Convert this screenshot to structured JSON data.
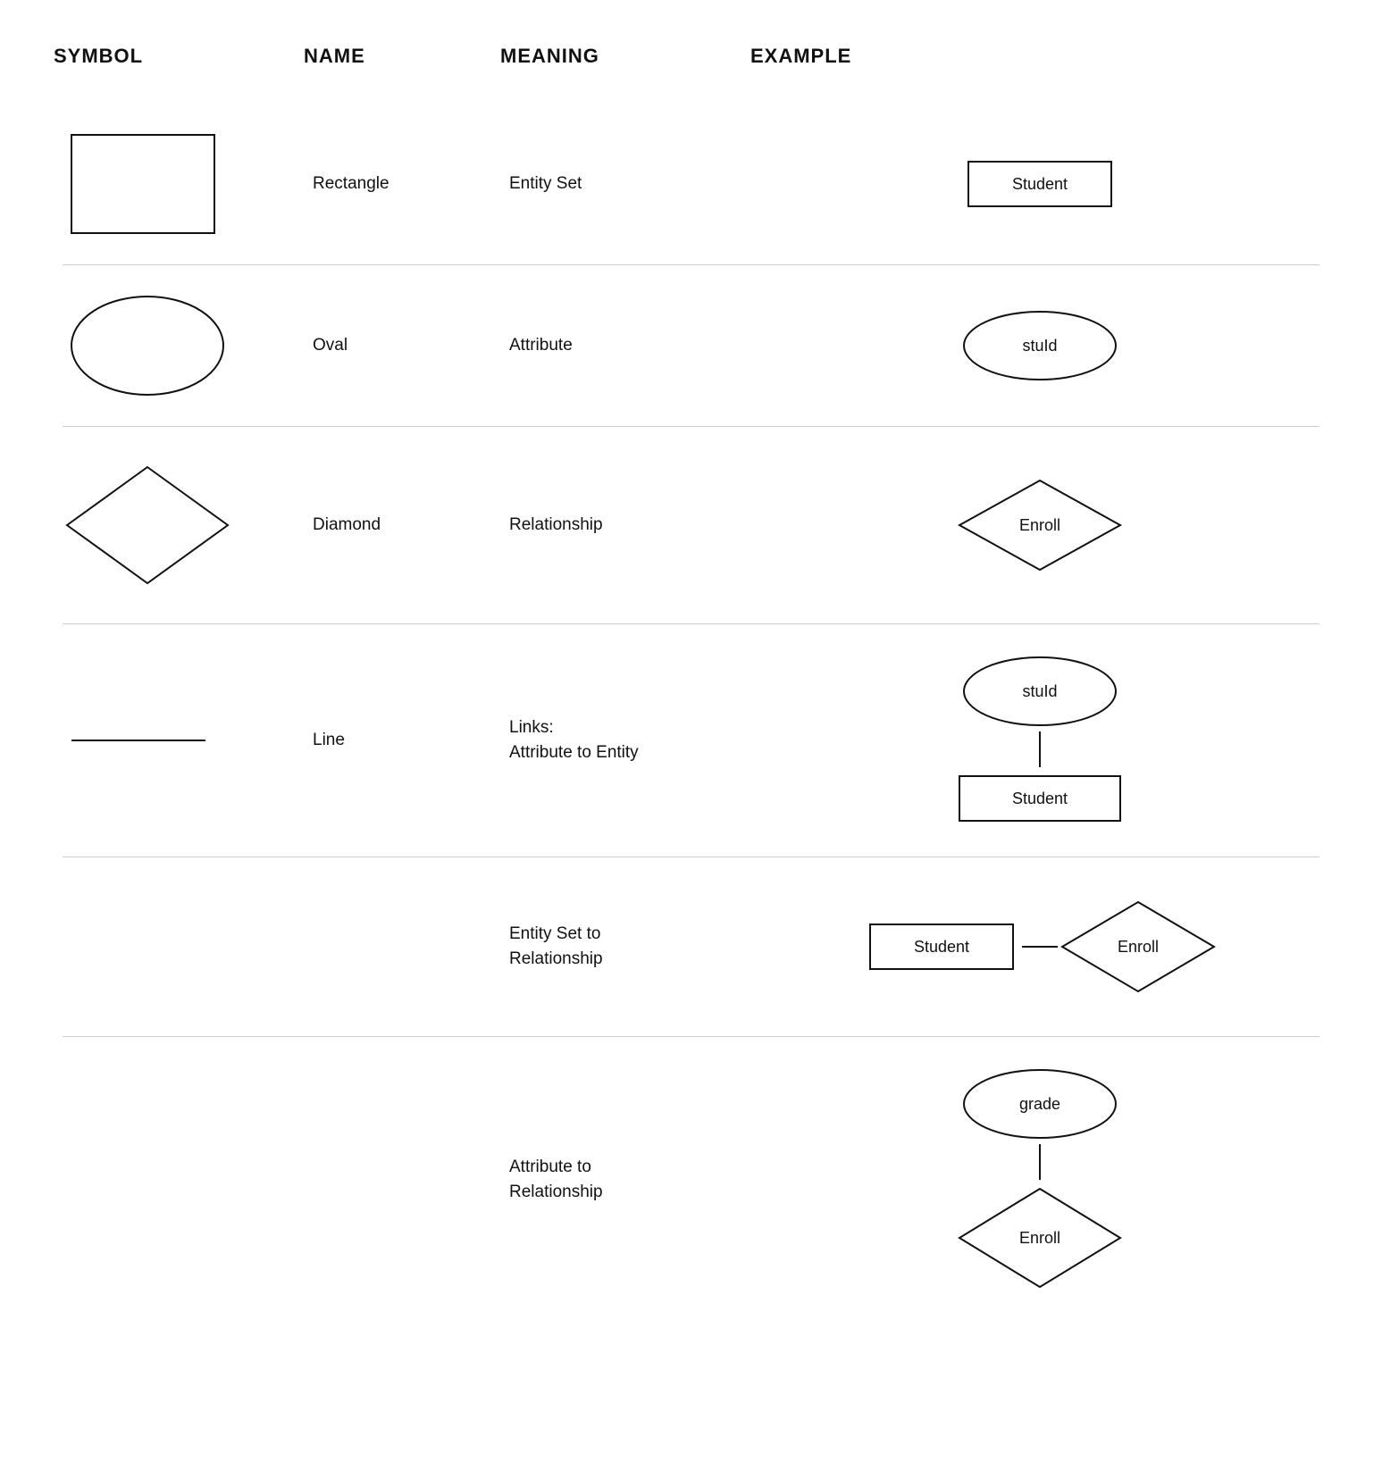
{
  "header": {
    "col1": "SYMBOL",
    "col2": "NAME",
    "col3": "MEANING",
    "col4": "EXAMPLE"
  },
  "rows": [
    {
      "id": "rectangle",
      "name": "Rectangle",
      "meaning": "Entity Set",
      "example_label": "Student"
    },
    {
      "id": "oval",
      "name": "Oval",
      "meaning": "Attribute",
      "example_label": "stuId"
    },
    {
      "id": "diamond",
      "name": "Diamond",
      "meaning": "Relationship",
      "example_label": "Enroll"
    },
    {
      "id": "line",
      "name": "Line",
      "meaning_line1": "Links:",
      "meaning_line2": "Attribute to Entity",
      "example_oval": "stuId",
      "example_rect": "Student"
    }
  ],
  "bottom_rows": [
    {
      "id": "entity-to-relationship",
      "meaning_line1": "Entity Set to",
      "meaning_line2": "Relationship",
      "example_rect": "Student",
      "example_diamond": "Enroll"
    },
    {
      "id": "attribute-to-relationship",
      "meaning_line1": "Attribute to",
      "meaning_line2": "Relationship",
      "example_oval": "grade",
      "example_diamond": "Enroll"
    }
  ]
}
